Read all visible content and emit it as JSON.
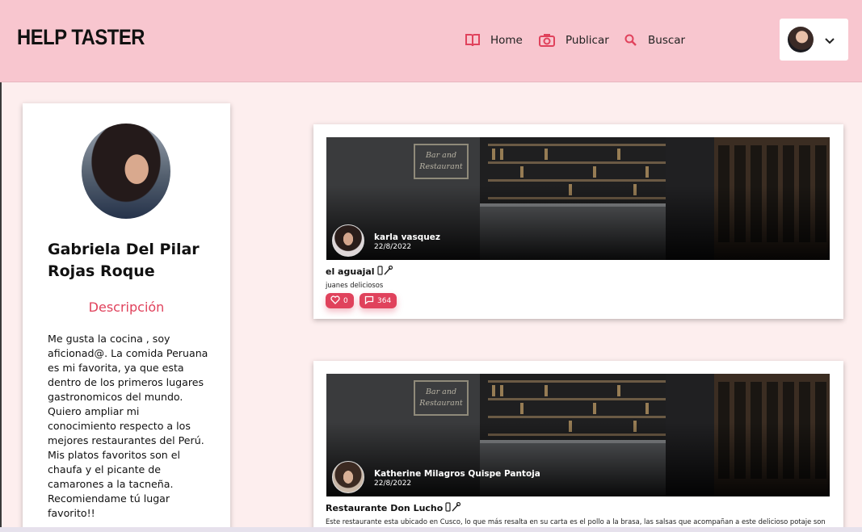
{
  "app": {
    "brand": "HELP TASTER"
  },
  "nav": {
    "items": [
      {
        "label": "Home",
        "icon": "book-icon"
      },
      {
        "label": "Publicar",
        "icon": "camera-icon"
      },
      {
        "label": "Buscar",
        "icon": "search-icon"
      }
    ]
  },
  "user_menu": {
    "icon": "chevron-down-icon"
  },
  "profile": {
    "name": "Gabriela Del Pilar Rojas Roque",
    "description_title": "Descripción",
    "description": "Me gusta la cocina , soy aficionad@. La comida Peruana es mi favorita, ya que esta dentro de los primeros lugares gastronomicos del mundo. Quiero ampliar mi conocimiento respecto a los mejores restaurantes del Perú. Mis platos favoritos son el chaufa y el picante de camarones a la tacneña. Recomiendame tú lugar favorito!!"
  },
  "posts": [
    {
      "author": "karla vasquez",
      "date": "22/8/2022",
      "title": "el aguajal",
      "body": "juanes deliciosos",
      "likes": "0",
      "comments": "364",
      "sign": "Bar and Restaurant"
    },
    {
      "author": "Katherine Milagros Quispe Pantoja",
      "date": "22/8/2022",
      "title": "Restaurante Don Lucho",
      "body": "Este restaurante esta ubicado en Cusco, lo que más resalta en su carta es el pollo a la brasa, las salsas que acompañan a este delicioso potaje son",
      "sign": "Bar and Restaurant"
    }
  ],
  "colors": {
    "header_bg": "#f8c6cf",
    "page_bg": "#fdeeee",
    "accent": "#e0425c"
  }
}
